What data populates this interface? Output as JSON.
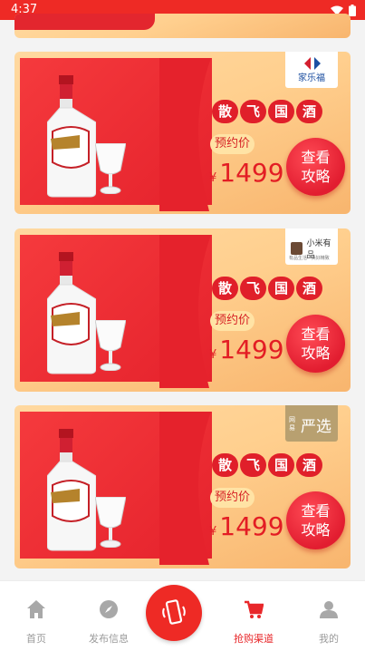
{
  "status_bar": {
    "time": "4:37"
  },
  "cards": [
    {
      "store": "家乐福",
      "title_chars": [
        "散",
        "飞",
        "国",
        "酒"
      ],
      "price_label": "预约价",
      "currency": "¥",
      "price": "1499",
      "cta": [
        "查看",
        "攻略"
      ]
    },
    {
      "store": "小米有品",
      "store_sub": "有品生活 · 美好精致",
      "title_chars": [
        "散",
        "飞",
        "国",
        "酒"
      ],
      "price_label": "预约价",
      "currency": "¥",
      "price": "1499",
      "cta": [
        "查看",
        "攻略"
      ]
    },
    {
      "store": "严选",
      "store_prefix": "网易",
      "title_chars": [
        "散",
        "飞",
        "国",
        "酒"
      ],
      "price_label": "预约价",
      "currency": "¥",
      "price": "1499",
      "cta": [
        "查看",
        "攻略"
      ]
    }
  ],
  "bottom_nav": {
    "items": [
      {
        "label": "首页",
        "icon": "home-icon"
      },
      {
        "label": "发布信息",
        "icon": "compass-icon"
      },
      {
        "label": "",
        "icon": "phone-shake-icon"
      },
      {
        "label": "抢购渠道",
        "icon": "cart-icon"
      },
      {
        "label": "我的",
        "icon": "user-icon"
      }
    ],
    "active_index": 3
  },
  "colors": {
    "brand_red": "#ee2a25",
    "card_gold": "#ffcf8e",
    "inactive": "#9a9a9a"
  }
}
